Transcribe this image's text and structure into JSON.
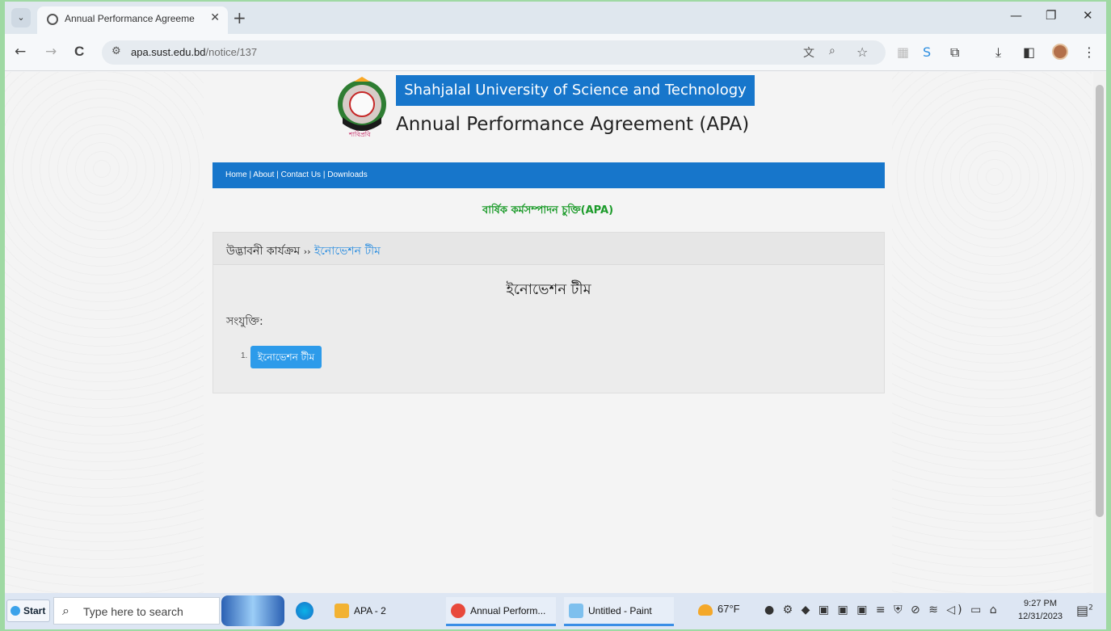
{
  "browser": {
    "tab": {
      "title": "Annual Performance Agreeme",
      "close": "✕"
    },
    "new_tab": "+",
    "window_controls": {
      "minimize": "—",
      "restore": "❐",
      "close": "✕"
    },
    "nav": {
      "back": "←",
      "forward": "→",
      "reload": "C"
    },
    "url": {
      "host": "apa.sust.edu.bd",
      "path": "/notice/137"
    }
  },
  "page": {
    "university": "Shahjalal University of Science and Technology",
    "apa_title": "Annual Performance Agreement (APA)",
    "logo_caption": "শাবিপ্রবি",
    "nav_links": [
      "Home",
      "About",
      "Contact Us",
      "Downloads"
    ],
    "nav_separator": " | ",
    "section_heading": "বার্ষিক কর্মসম্পাদন চুক্তি(APA)",
    "breadcrumb": {
      "parent": "উদ্ভাবনী কার্যক্রম",
      "separator": "››",
      "current": "ইনোভেশন টীম"
    },
    "notice_title": "ইনোভেশন টীম",
    "attachments_label": "সংযুক্তি:",
    "attachments": [
      {
        "num": "1.",
        "label": "ইনোভেশন টীম"
      }
    ]
  },
  "taskbar": {
    "start": "Start",
    "search_placeholder": "Type here to search",
    "items": [
      {
        "label": "APA - 2",
        "color": "#f2b233"
      },
      {
        "label": "Annual Perform...",
        "color": "#e8493c"
      },
      {
        "label": "Untitled - Paint",
        "color": "#7ec0ee"
      }
    ],
    "weather": "67°F",
    "time": "9:27 PM",
    "date": "12/31/2023",
    "notification_count": "2"
  },
  "colors": {
    "brand_blue": "#1776cb",
    "heading_green": "#1c9b2a",
    "link_blue": "#2c8ee0",
    "button_blue": "#2d9bea"
  }
}
